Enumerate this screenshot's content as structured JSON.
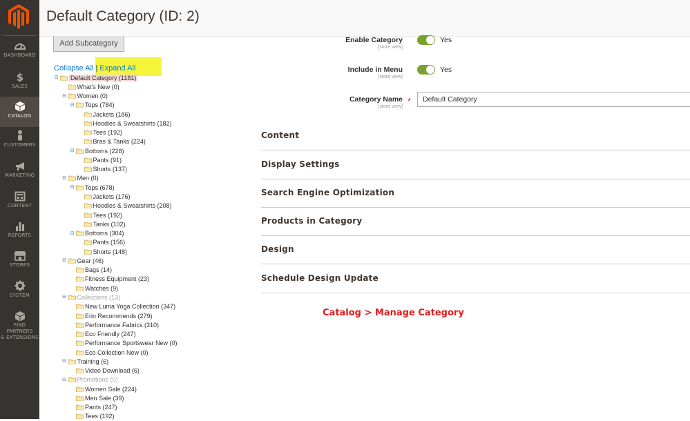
{
  "page": {
    "title": "Default Category (ID: 2)"
  },
  "sidebar": {
    "items": [
      {
        "label": "DASHBOARD",
        "icon": "dashboard-icon"
      },
      {
        "label": "SALES",
        "icon": "dollar-icon"
      },
      {
        "label": "CATALOG",
        "icon": "cube-icon",
        "active": true
      },
      {
        "label": "CUSTOMERS",
        "icon": "person-icon"
      },
      {
        "label": "MARKETING",
        "icon": "megaphone-icon"
      },
      {
        "label": "CONTENT",
        "icon": "layout-icon"
      },
      {
        "label": "REPORTS",
        "icon": "bar-chart-icon"
      },
      {
        "label": "STORES",
        "icon": "storefront-icon"
      },
      {
        "label": "SYSTEM",
        "icon": "gear-icon"
      },
      {
        "label": "FIND PARTNERS",
        "label2": "& EXTENSIONS",
        "icon": "extensions-icon"
      }
    ]
  },
  "tree_panel": {
    "add_subcategory_label": "Add Subcategory",
    "collapse_all": "Collapse All",
    "separator": "|",
    "expand_all": "Expand All",
    "nodes": [
      {
        "label": "Default Category (1181)",
        "depth": 0,
        "toggle": "minus",
        "selected": true
      },
      {
        "label": "What's New (0)",
        "depth": 1
      },
      {
        "label": "Women (0)",
        "depth": 1,
        "toggle": "minus"
      },
      {
        "label": "Tops (784)",
        "depth": 2,
        "toggle": "minus"
      },
      {
        "label": "Jackets (186)",
        "depth": 3
      },
      {
        "label": "Hoodies & Sweatshirts (182)",
        "depth": 3
      },
      {
        "label": "Tees (192)",
        "depth": 3
      },
      {
        "label": "Bras & Tanks (224)",
        "depth": 3
      },
      {
        "label": "Bottoms (228)",
        "depth": 2,
        "toggle": "minus"
      },
      {
        "label": "Pants (91)",
        "depth": 3
      },
      {
        "label": "Shorts (137)",
        "depth": 3
      },
      {
        "label": "Men (0)",
        "depth": 1,
        "toggle": "minus"
      },
      {
        "label": "Tops (678)",
        "depth": 2,
        "toggle": "minus"
      },
      {
        "label": "Jackets (176)",
        "depth": 3
      },
      {
        "label": "Hoodies & Sweatshirts (208)",
        "depth": 3
      },
      {
        "label": "Tees (192)",
        "depth": 3
      },
      {
        "label": "Tanks (102)",
        "depth": 3
      },
      {
        "label": "Bottoms (304)",
        "depth": 2,
        "toggle": "minus"
      },
      {
        "label": "Pants (156)",
        "depth": 3
      },
      {
        "label": "Shorts (148)",
        "depth": 3
      },
      {
        "label": "Gear (46)",
        "depth": 1,
        "toggle": "minus"
      },
      {
        "label": "Bags (14)",
        "depth": 2
      },
      {
        "label": "Fitness Equipment (23)",
        "depth": 2
      },
      {
        "label": "Watches (9)",
        "depth": 2
      },
      {
        "label": "Collections (13)",
        "depth": 1,
        "toggle": "minus",
        "disabled": true
      },
      {
        "label": "New Luma Yoga Collection (347)",
        "depth": 2
      },
      {
        "label": "Erin Recommends (279)",
        "depth": 2
      },
      {
        "label": "Performance Fabrics (310)",
        "depth": 2
      },
      {
        "label": "Eco Friendly (247)",
        "depth": 2
      },
      {
        "label": "Performance Sportswear New (0)",
        "depth": 2
      },
      {
        "label": "Eco Collection New (0)",
        "depth": 2
      },
      {
        "label": "Training (6)",
        "depth": 1,
        "toggle": "minus"
      },
      {
        "label": "Video Download (6)",
        "depth": 2
      },
      {
        "label": "Promotions (0)",
        "depth": 1,
        "toggle": "minus",
        "disabled": true
      },
      {
        "label": "Women Sale (224)",
        "depth": 2
      },
      {
        "label": "Men Sale (39)",
        "depth": 2
      },
      {
        "label": "Pants (247)",
        "depth": 2
      },
      {
        "label": "Tees (192)",
        "depth": 2
      }
    ]
  },
  "form": {
    "enable_category": {
      "label": "Enable Category",
      "scope": "[store view]",
      "value": "Yes",
      "on": true
    },
    "include_in_menu": {
      "label": "Include in Menu",
      "scope": "[store view]",
      "value": "Yes",
      "on": true
    },
    "category_name": {
      "label": "Category Name",
      "scope": "[store view]",
      "required_mark": "*",
      "value": "Default Category"
    },
    "sections": [
      "Content",
      "Display Settings",
      "Search Engine Optimization",
      "Products in Category",
      "Design",
      "Schedule Design Update"
    ]
  },
  "annotation": "Catalog > Manage Category",
  "colors": {
    "sidebar_bg": "#373330",
    "sidebar_active": "#514943",
    "logo_orange": "#eb5202",
    "toggle_green": "#79a22e",
    "link_blue": "#007bdb",
    "highlight_yellow": "#f5f53c",
    "annotation_red": "#e21c1c"
  }
}
